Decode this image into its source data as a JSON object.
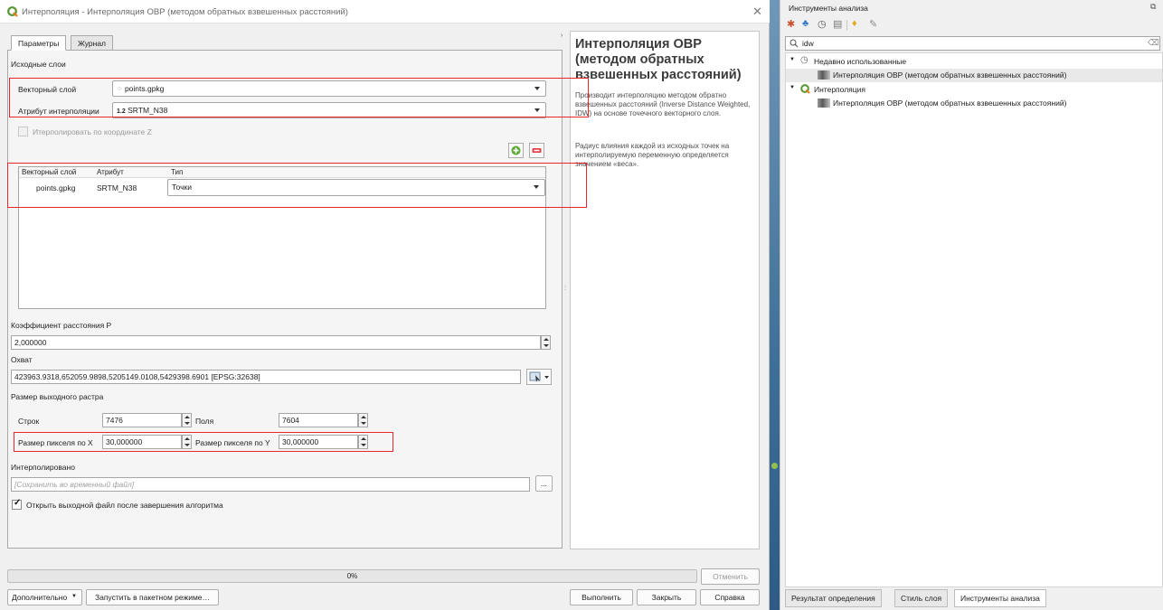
{
  "dialog": {
    "title": "Интерполяция - Интерполяция ОВР (методом обратных взвешенных расстояний)",
    "close_glyph": "✕",
    "tabs": [
      "Параметры",
      "Журнал"
    ],
    "input_layers_heading": "Исходные слои",
    "vector_layer_label": "Векторный слой",
    "vector_layer_value": "points.gpkg",
    "attribute_label": "Атрибут интерполяции",
    "attribute_prefix": "1.2",
    "attribute_value": "SRTM_N38",
    "use_z_label": "Итерполировать по координате Z",
    "table": {
      "columns": [
        "Векторный слой",
        "Атрибут",
        "Тип"
      ],
      "rows": [
        {
          "layer": "points.gpkg",
          "attribute": "SRTM_N38",
          "type": "Точки"
        }
      ]
    },
    "distance_coef_label": "Коэффициент расстояния P",
    "distance_coef_value": "2,000000",
    "extent_label": "Охват",
    "extent_value": "423963.9318,652059.9898,5205149.0108,5429398.6901 [EPSG:32638]",
    "raster_size_label": "Размер выходного растра",
    "rows_label": "Строк",
    "rows_value": "7476",
    "cols_label": "Поля",
    "cols_value": "7604",
    "pixel_x_label": "Размер пикселя по X",
    "pixel_x_value": "30,000000",
    "pixel_y_label": "Размер пикселя по Y",
    "pixel_y_value": "30,000000",
    "output_label": "Интерполировано",
    "output_placeholder": "[Сохранить во временный файл]",
    "browse_label": "...",
    "open_output_label": "Открыть выходной файл после завершения алгоритма",
    "progress_text": "0%",
    "progress_value": 0,
    "cancel_label": "Отменить",
    "advanced_label": "Дополнительно",
    "batch_label": "Запустить в пакетном режиме…",
    "run_label": "Выполнить",
    "close_label": "Закрыть",
    "help_label": "Справка"
  },
  "help": {
    "title": "Интерполяция ОВР (методом обратных взвешенных расстояний)",
    "p1": "Производит интерполяцию методом обратно взвешенных расстояний (Inverse Distance Weighted, IDW) на основе точечного векторного слоя.",
    "p2": "Радиус влияния каждой из исходных точек на интерполируемую переменную определяется значением «веса»."
  },
  "toolbox": {
    "title": "Инструменты анализа",
    "search_value": "idw",
    "groups": [
      {
        "label": "Недавно использованные",
        "item": "Интерполяция ОВР (методом обратных взвешенных расстояний)"
      },
      {
        "label": "Интерполяция",
        "item": "Интерполяция ОВР (методом обратных взвешенных расстояний)"
      }
    ],
    "bottom_tabs": [
      "Результат определения",
      "Стиль слоя",
      "Инструменты анализа"
    ]
  },
  "colors": {
    "highlight_red": "#e8262e",
    "qgis_green": "#589632"
  }
}
